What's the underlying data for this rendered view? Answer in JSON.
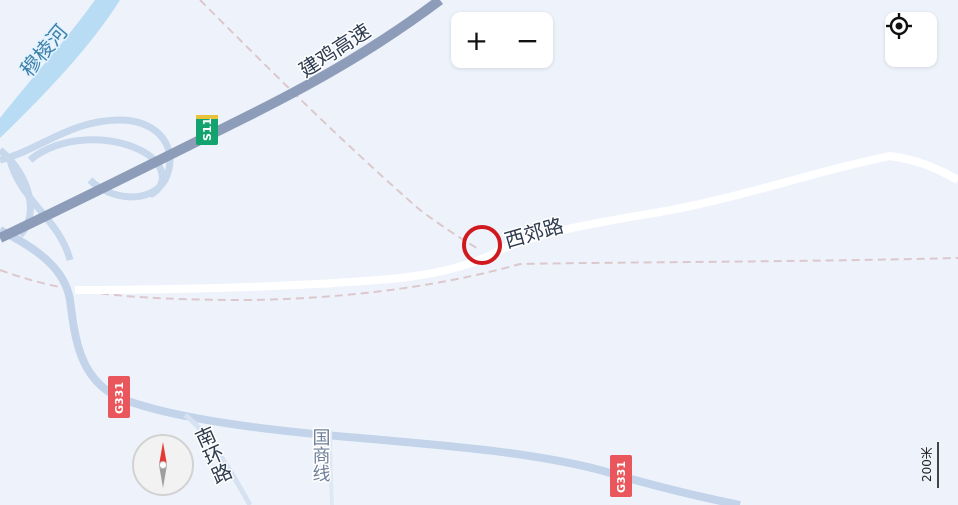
{
  "map": {
    "colors": {
      "background": "#eef3fb",
      "expressway": "#8d9cb8",
      "national_road": "#c3d4ea",
      "minor_road": "#ffffff",
      "railway": "#dcc8cc",
      "river": "#b9dcf5",
      "marker": "#d0191f",
      "shield_expressway": "#12a36e",
      "shield_national": "#e9565b"
    },
    "roads": {
      "expressway_name": "建鸡高速",
      "xijiao_name": "西郊路",
      "nanhuan_name": "南环路",
      "guoshang_name": "国商线"
    },
    "river_name": "穆棱河",
    "shields": {
      "s11": "S11",
      "g331_left": "G331",
      "g331_right": "G331"
    }
  },
  "controls": {
    "zoom_in_label": "+",
    "zoom_out_label": "−",
    "locate_icon": "crosshair-target-icon",
    "compass_icon": "compass-needle-icon"
  },
  "scale_bar": {
    "label": "200米"
  }
}
